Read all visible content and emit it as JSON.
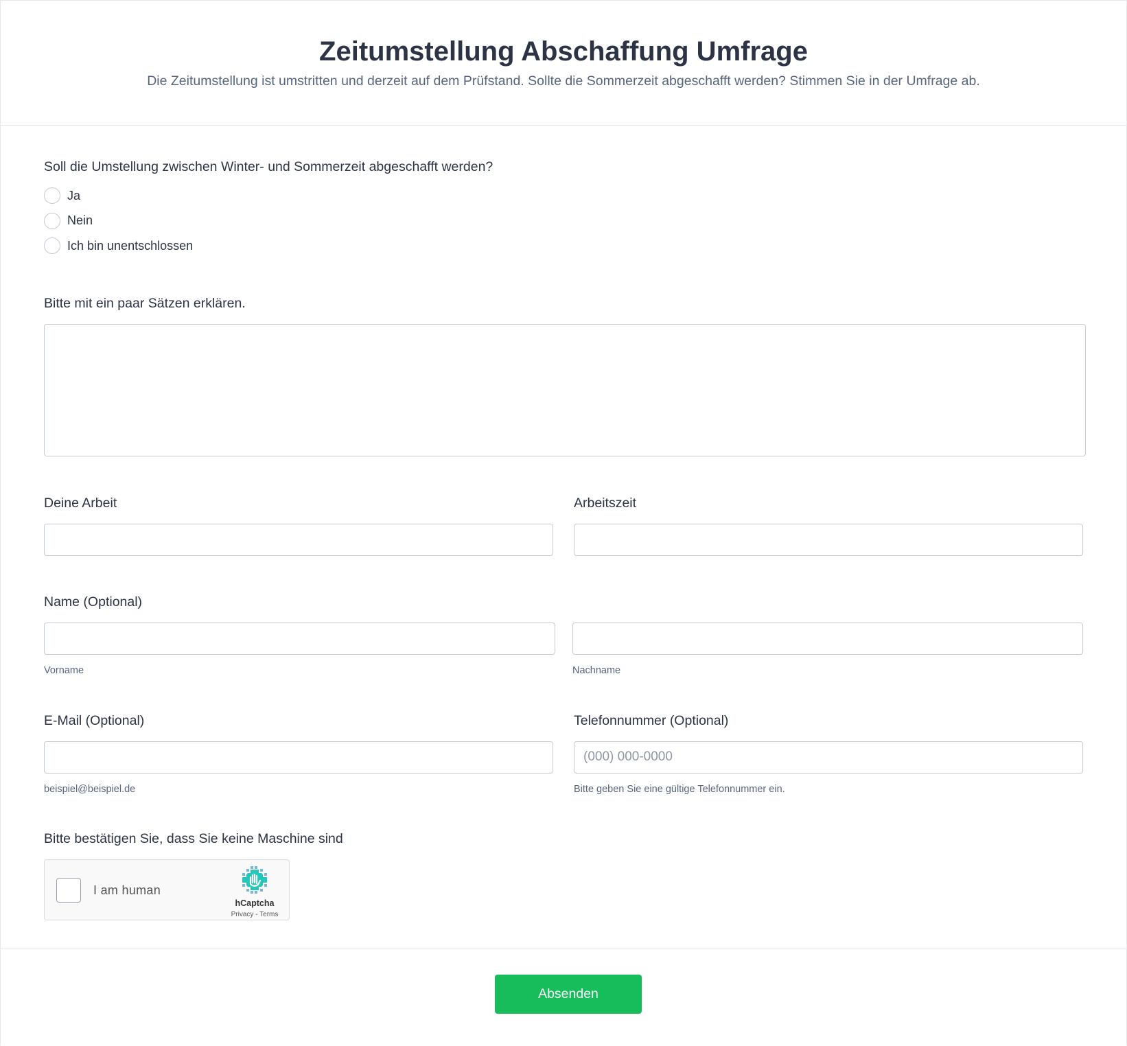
{
  "header": {
    "title": "Zeitumstellung Abschaffung Umfrage",
    "subtitle": "Die Zeitumstellung ist umstritten und derzeit auf dem Prüfstand. Sollte die Sommerzeit abgeschafft werden? Stimmen Sie in der Umfrage ab."
  },
  "question1": {
    "label": "Soll die Umstellung zwischen Winter- und Sommerzeit abgeschafft werden?",
    "options": [
      "Ja",
      "Nein",
      "Ich bin unentschlossen"
    ]
  },
  "explain": {
    "label": "Bitte mit ein paar Sätzen erklären.",
    "value": ""
  },
  "work": {
    "label": "Deine Arbeit",
    "value": ""
  },
  "worktime": {
    "label": "Arbeitszeit",
    "value": ""
  },
  "name": {
    "label": "Name (Optional)",
    "first_sublabel": "Vorname",
    "last_sublabel": "Nachname",
    "first_value": "",
    "last_value": ""
  },
  "email": {
    "label": "E-Mail (Optional)",
    "sublabel": "beispiel@beispiel.de",
    "value": ""
  },
  "phone": {
    "label": "Telefonnummer (Optional)",
    "placeholder": "(000) 000-0000",
    "sublabel": "Bitte geben Sie eine gültige Telefonnummer ein.",
    "value": ""
  },
  "captcha": {
    "label": "Bitte bestätigen Sie, dass Sie keine Maschine sind",
    "checkbox_text": "I am human",
    "brand": "hCaptcha",
    "links": "Privacy - Terms",
    "icon": "hcaptcha-hand-icon"
  },
  "footer": {
    "submit_label": "Absenden"
  },
  "colors": {
    "accent": "#18bd5b",
    "text": "#2c3345",
    "muted": "#57647e",
    "border": "#c3cad8"
  }
}
